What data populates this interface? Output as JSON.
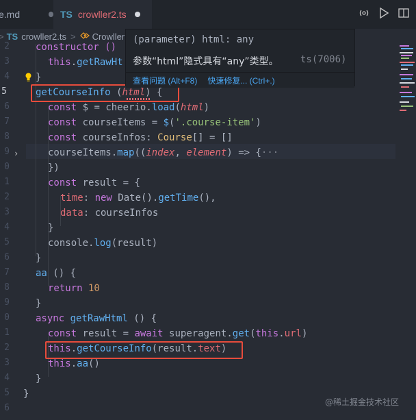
{
  "tabs": [
    {
      "label": "e.md",
      "dirty": true
    },
    {
      "icon": "TS",
      "label": "crowller2.ts",
      "dirty": true
    }
  ],
  "breadcrumb": {
    "file_icon": "TS",
    "file": "crowller2.ts",
    "separator": ">",
    "class_name": "Crowller"
  },
  "hover": {
    "signature": "(parameter) html: any",
    "message": "参数“html”隐式具有“any”类型。",
    "code": "ts(7006)",
    "action_view": "查看问题 (Alt+F8)",
    "action_fix": "快速修复... (Ctrl+.)"
  },
  "line_numbers": [
    "2",
    "3",
    "4",
    "5",
    "6",
    "7",
    "8",
    "9",
    "0",
    "1",
    "2",
    "3",
    "4",
    "5",
    "6",
    "7",
    "8",
    "9",
    "0",
    "1",
    "2",
    "3",
    "4",
    "5",
    "6",
    "7"
  ],
  "code": {
    "l1": "constructor ()",
    "l2_this": "this",
    "l2_fn": "getRawHt",
    "l3": "}",
    "l4_fn": "getCourseInfo",
    "l4_open": " (",
    "l4_param": "html",
    "l4_close": ") {",
    "l5_const": "const",
    "l5_var": " $ = ",
    "l5_obj": "cheerio",
    "l5_dot": ".",
    "l5_fn": "load",
    "l5_open": "(",
    "l5_param": "html",
    "l5_close": ")",
    "l6_const": "const",
    "l6_var": " courseItems = ",
    "l6_fn": "$",
    "l6_open": "(",
    "l6_str": "'.course-item'",
    "l6_close": ")",
    "l7_const": "const",
    "l7_var": " courseInfos: ",
    "l7_type": "Course",
    "l7_rest": "[] = []",
    "l8_obj": "courseItems",
    "l8_dot": ".",
    "l8_fn": "map",
    "l8_open": "((",
    "l8_p1": "index",
    "l8_comma": ", ",
    "l8_p2": "element",
    "l8_arrow": ") => {",
    "l8_fold": "···",
    "l9": "})",
    "l10_const": "const",
    "l10_var": " result = {",
    "l11_key": "time",
    "l11_colon": ": ",
    "l11_new": "new",
    "l11_type": " Date",
    "l11_mid": "().",
    "l11_fn": "getTime",
    "l11_end": "(),",
    "l12_key": "data",
    "l12_colon": ": ",
    "l12_val": "courseInfos",
    "l13": "}",
    "l14_obj": "console",
    "l14_dot": ".",
    "l14_fn": "log",
    "l14_args": "(result)",
    "l15": "}",
    "l16_fn": "aa",
    "l16_rest": " () {",
    "l17_kw": "return",
    "l17_num": " 10",
    "l18": "}",
    "l19_kw": "async",
    "l19_fn": " getRawHtml",
    "l19_rest": " () {",
    "l20_const": "const",
    "l20_var": " result = ",
    "l20_await": "await",
    "l20_obj": " superagent",
    "l20_dot": ".",
    "l20_fn": "get",
    "l20_open": "(",
    "l20_this": "this",
    "l20_dot2": ".",
    "l20_prop": "url",
    "l20_close": ")",
    "l21_this": "this",
    "l21_dot": ".",
    "l21_fn": "getCourseInfo",
    "l21_open": "(",
    "l21_obj": "result",
    "l21_dot2": ".",
    "l21_prop": "text",
    "l21_close": ")",
    "l22_this": "this",
    "l22_dot": ".",
    "l22_fn": "aa",
    "l22_args": "()",
    "l23": "}",
    "l24": "}"
  },
  "watermark": "@稀土掘金技术社区",
  "colors": {
    "editor_bg": "#282c34",
    "highlight_box": "#e74c3c",
    "keyword": "#c678dd",
    "function": "#61afef",
    "parameter": "#e06c75",
    "string": "#98c379",
    "number": "#d19a66",
    "type": "#e5c07b"
  }
}
